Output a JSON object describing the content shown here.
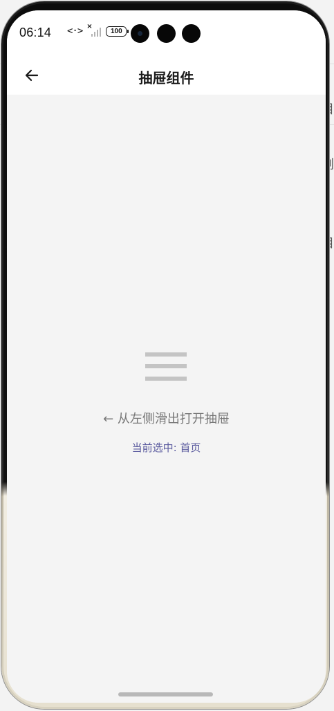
{
  "status_bar": {
    "time": "06:14",
    "data_icon": "<·>",
    "signal_icon": "signal-no-service-icon",
    "battery_level": "100"
  },
  "nav": {
    "back_icon": "arrow-left-icon",
    "title": "抽屉组件"
  },
  "main": {
    "menu_icon": "hamburger-menu-icon",
    "hint": "← 从左侧滑出打开抽屉",
    "selected_prefix": "当前选中: ",
    "selected_value": "首页"
  },
  "background_edge": {
    "glyphs": [
      "目",
      "剧",
      "丨",
      "目"
    ]
  },
  "colors": {
    "content_bg": "#f4f4f4",
    "header_bg": "#ffffff",
    "hint_text": "#777777",
    "selected_text": "#5a5a9e",
    "menu_icon": "#c4c4c4"
  }
}
